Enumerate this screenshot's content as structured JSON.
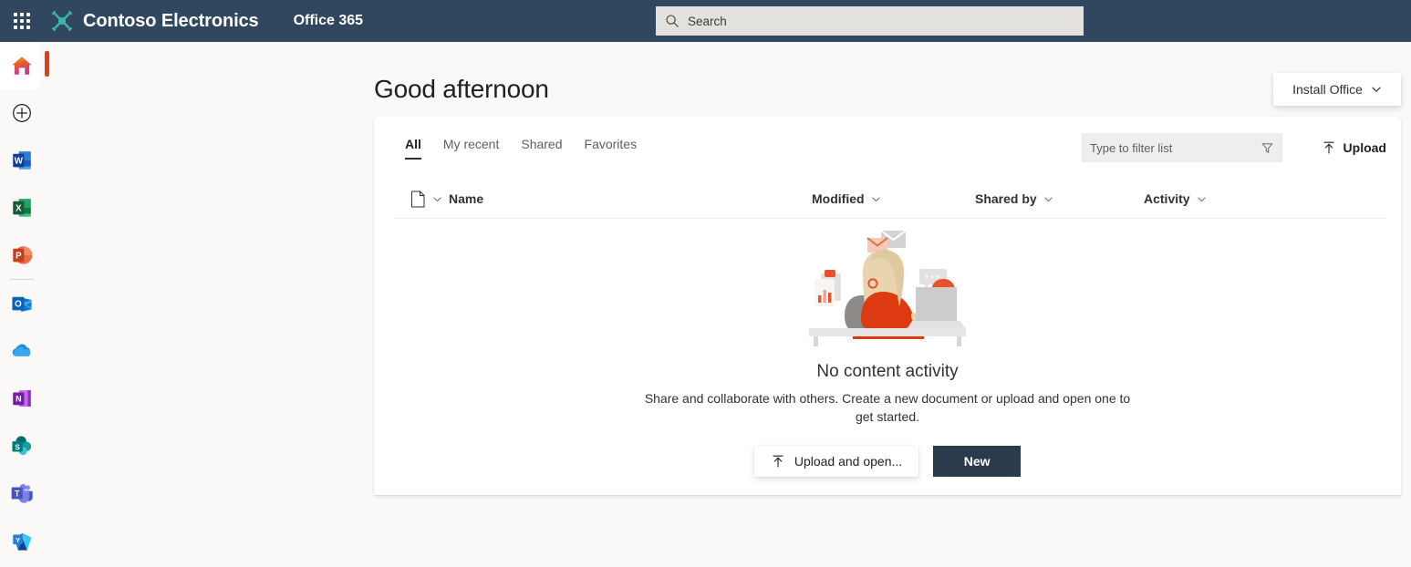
{
  "topbar": {
    "waffle_label": "app-launcher",
    "logo_icon": "contoso-drone-logo",
    "brand": "Contoso Electronics",
    "app_name": "Office 365",
    "background": "#31465f",
    "search": {
      "icon": "search-icon",
      "placeholder": "Search",
      "value": ""
    }
  },
  "rail": {
    "items": [
      {
        "name": "home",
        "icon": "home-icon",
        "label": "Home",
        "active": true
      },
      {
        "name": "create",
        "icon": "plus-circle-icon",
        "label": "Create",
        "active": false
      },
      {
        "name": "word",
        "icon": "word-icon",
        "label": "Word",
        "active": false
      },
      {
        "name": "excel",
        "icon": "excel-icon",
        "label": "Excel",
        "active": false
      },
      {
        "name": "powerpoint",
        "icon": "powerpoint-icon",
        "label": "PowerPoint",
        "active": false
      },
      {
        "name": "outlook",
        "icon": "outlook-icon",
        "label": "Outlook",
        "active": false
      },
      {
        "name": "onedrive",
        "icon": "onedrive-icon",
        "label": "OneDrive",
        "active": false
      },
      {
        "name": "onenote",
        "icon": "onenote-icon",
        "label": "OneNote",
        "active": false
      },
      {
        "name": "sharepoint",
        "icon": "sharepoint-icon",
        "label": "SharePoint",
        "active": false
      },
      {
        "name": "teams",
        "icon": "teams-icon",
        "label": "Teams",
        "active": false
      },
      {
        "name": "yammer",
        "icon": "yammer-icon",
        "label": "Yammer",
        "active": false
      }
    ],
    "active_indicator_color": "#e53b16"
  },
  "main": {
    "greeting": "Good afternoon",
    "install_button": {
      "label": "Install Office",
      "icon": "chevron-down-icon"
    },
    "tabs": [
      {
        "label": "All",
        "active": true
      },
      {
        "label": "My recent",
        "active": false
      },
      {
        "label": "Shared",
        "active": false
      },
      {
        "label": "Favorites",
        "active": false
      }
    ],
    "filter": {
      "placeholder": "Type to filter list",
      "value": "",
      "icon": "filter-funnel-icon"
    },
    "upload_link": {
      "label": "Upload",
      "icon": "upload-arrow-icon"
    },
    "columns": [
      {
        "key": "file",
        "label": "",
        "icon": "file-type-icon"
      },
      {
        "key": "name",
        "label": "Name",
        "icon": ""
      },
      {
        "key": "modified",
        "label": "Modified",
        "icon": "chevron-down-icon"
      },
      {
        "key": "shared_by",
        "label": "Shared by",
        "icon": "chevron-down-icon"
      },
      {
        "key": "activity",
        "label": "Activity",
        "icon": "chevron-down-icon"
      }
    ],
    "rows": [],
    "empty_state": {
      "illustration": "person-at-desk-with-laptop-illustration",
      "title": "No content activity",
      "description": "Share and collaborate with others. Create a new document or upload and open one to get started.",
      "upload_open_button": {
        "label": "Upload and open...",
        "icon": "upload-arrow-icon"
      },
      "new_button": {
        "label": "New"
      }
    }
  },
  "colors": {
    "topbar": "#31465f",
    "page_background": "#faf9f8",
    "card": "#ffffff",
    "accent_red": "#e53b16",
    "primary_button": "#2b3a4d"
  }
}
